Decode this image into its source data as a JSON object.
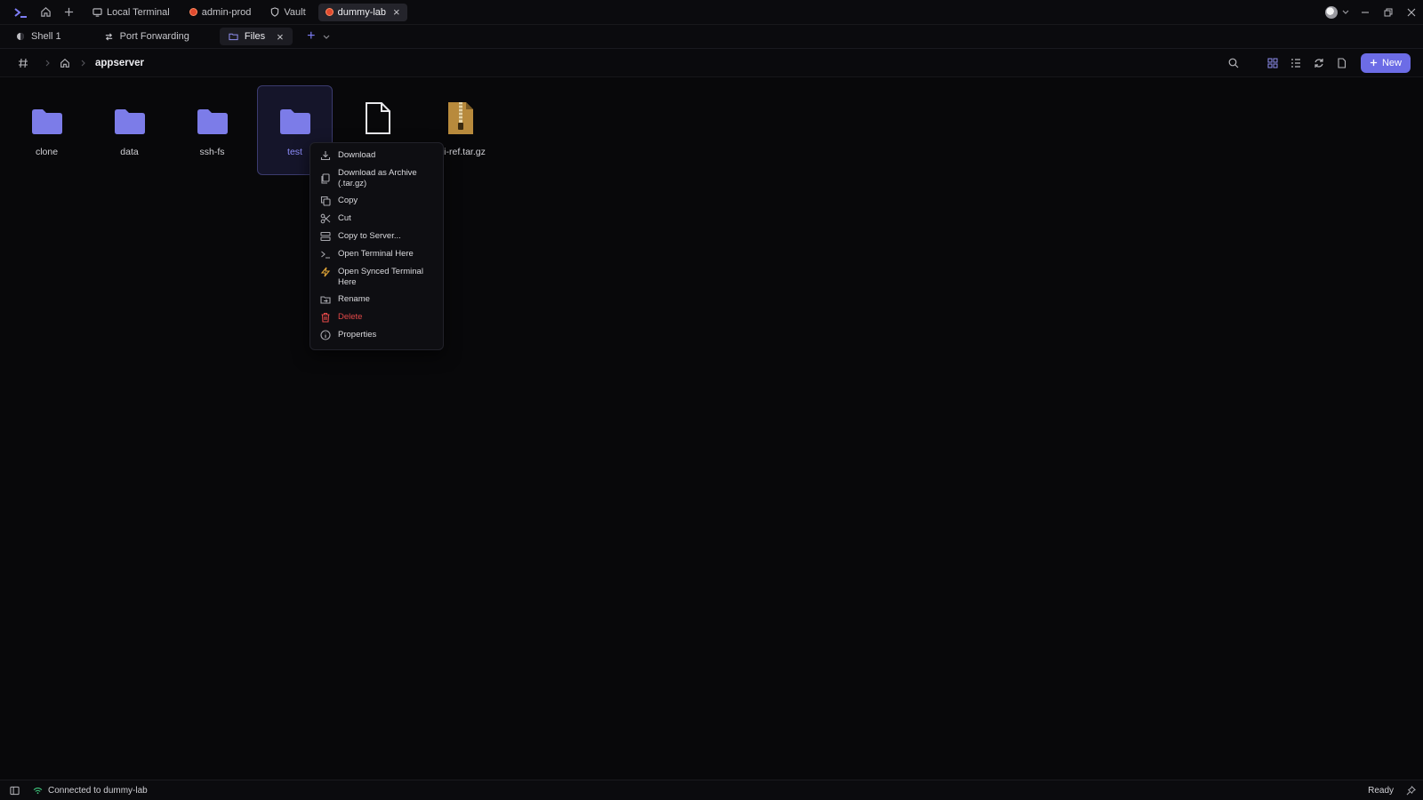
{
  "titlebar": {
    "tabs": [
      {
        "label": "Local Terminal",
        "icon": "monitor-icon"
      },
      {
        "label": "admin-prod",
        "icon": "server-status-icon"
      },
      {
        "label": "Vault",
        "icon": "shield-icon"
      },
      {
        "label": "dummy-lab",
        "icon": "server-status-icon",
        "active": true
      }
    ]
  },
  "session_tabs": [
    {
      "label": "Shell 1"
    },
    {
      "label": "Port Forwarding"
    },
    {
      "label": "Files",
      "active": true
    }
  ],
  "path": {
    "current": "appserver"
  },
  "toolbar": {
    "new_label": "New"
  },
  "files": [
    {
      "name": "clone",
      "type": "folder"
    },
    {
      "name": "data",
      "type": "folder"
    },
    {
      "name": "ssh-fs",
      "type": "folder"
    },
    {
      "name": "test",
      "type": "folder",
      "selected": true
    },
    {
      "name": "",
      "type": "file"
    },
    {
      "name": "i-ref.tar.gz",
      "type": "archive"
    }
  ],
  "context_menu": {
    "items": [
      {
        "label": "Download",
        "icon": "download-icon"
      },
      {
        "label": "Download as Archive (.tar.gz)",
        "icon": "archive-icon"
      },
      {
        "label": "Copy",
        "icon": "copy-icon"
      },
      {
        "label": "Cut",
        "icon": "scissors-icon"
      },
      {
        "label": "Copy to Server...",
        "icon": "server-icon"
      },
      {
        "label": "Open Terminal Here",
        "icon": "terminal-icon"
      },
      {
        "label": "Open Synced Terminal Here",
        "icon": "bolt-icon"
      },
      {
        "label": "Rename",
        "icon": "rename-icon"
      },
      {
        "label": "Delete",
        "icon": "trash-icon"
      },
      {
        "label": "Properties",
        "icon": "info-icon"
      }
    ]
  },
  "status": {
    "connection": "Connected to dummy-lab",
    "state": "Ready"
  },
  "colors": {
    "accent": "#6c6ce6",
    "danger": "#e34848",
    "folder": "#7c7ce8",
    "background": "#08080a"
  }
}
